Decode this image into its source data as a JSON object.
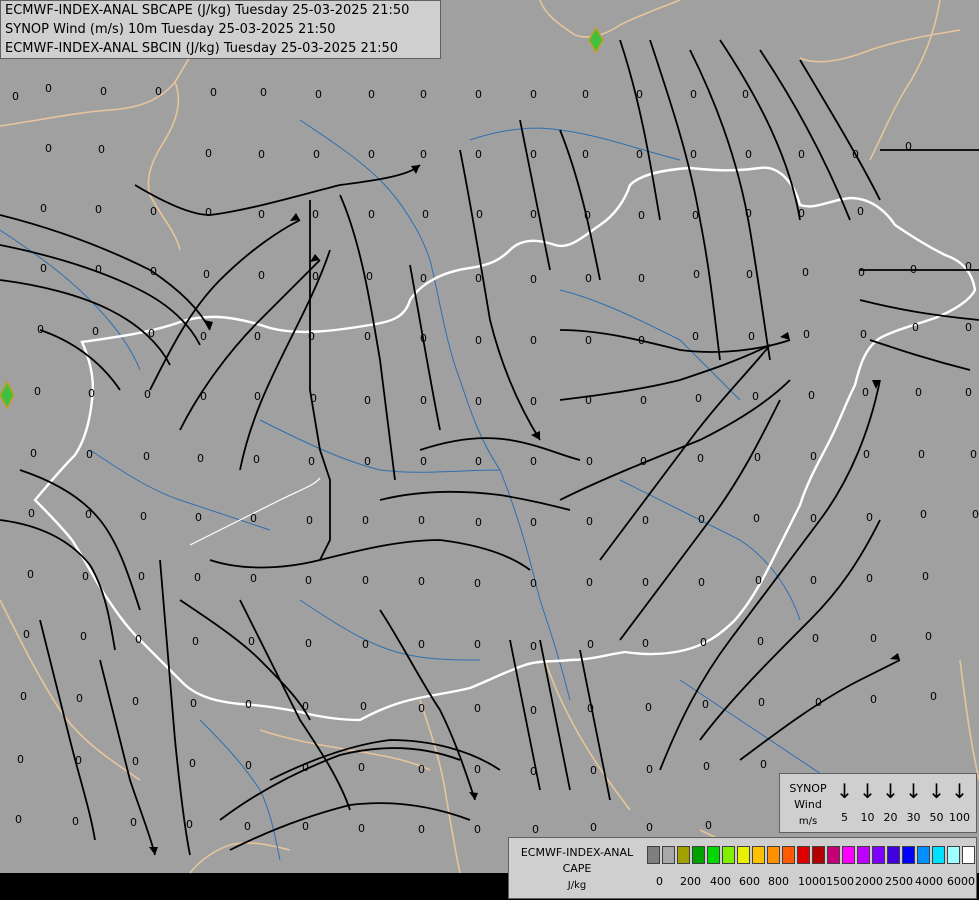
{
  "header": {
    "line1": "ECMWF-INDEX-ANAL SBCAPE (J/kg) Tuesday 25-03-2025 21:50",
    "line2": "SYNOP Wind (m/s) 10m Tuesday 25-03-2025 21:50",
    "line3": "ECMWF-INDEX-ANAL SBCIN (J/kg) Tuesday 25-03-2025 21:50"
  },
  "map": {
    "background_color": "#a0a0a0",
    "country_border_color": "#e6c59a",
    "national_border_color": "#ffffff",
    "river_color": "#2f6fb0",
    "streamline_color": "#000000",
    "field_value_label": "0"
  },
  "synop_legend": {
    "title_line1": "SYNOP",
    "title_line2": "Wind",
    "title_line3": "m/s",
    "arrow_glyph": "↓",
    "speeds": [
      "5",
      "10",
      "20",
      "30",
      "50",
      "100"
    ]
  },
  "cape_legend": {
    "title_line1": "ECMWF-INDEX-ANAL",
    "title_line2": "CAPE",
    "unit": "J/kg",
    "colors": [
      "#7f7f7f",
      "#a8a8a8",
      "#a0a000",
      "#00a000",
      "#00d800",
      "#80f000",
      "#e8f000",
      "#ffc000",
      "#ff9000",
      "#ff5a00",
      "#e00000",
      "#b40000",
      "#c80078",
      "#ff00ff",
      "#c000ff",
      "#8000ff",
      "#4000e0",
      "#0000ff",
      "#0090ff",
      "#00e0ff",
      "#a0ffff",
      "#ffffff"
    ],
    "ticks": [
      "0",
      "200",
      "400",
      "600",
      "800",
      "1000",
      "1500",
      "2000",
      "2500",
      "4000",
      "6000"
    ]
  }
}
